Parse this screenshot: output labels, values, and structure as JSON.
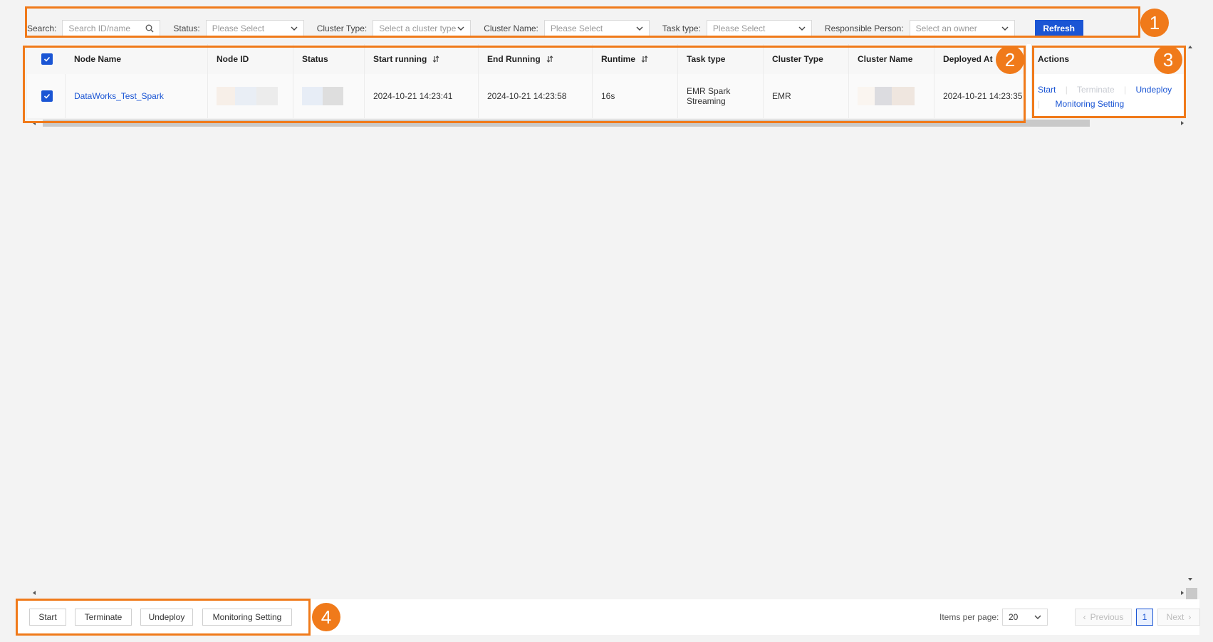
{
  "filters": {
    "search_label": "Search:",
    "search_placeholder": "Search ID/name",
    "status_label": "Status:",
    "status_value": "Please Select",
    "cluster_type_label": "Cluster Type:",
    "cluster_type_value": "Select a cluster type",
    "cluster_name_label": "Cluster Name:",
    "cluster_name_value": "Please Select",
    "task_type_label": "Task type:",
    "task_type_value": "Please Select",
    "responsible_label": "Responsible Person:",
    "responsible_value": "Select an owner",
    "refresh_label": "Refresh"
  },
  "table": {
    "headers": {
      "node_name": "Node Name",
      "node_id": "Node ID",
      "status": "Status",
      "start_running": "Start running",
      "end_running": "End Running",
      "runtime": "Runtime",
      "task_type": "Task type",
      "cluster_type": "Cluster Type",
      "cluster_name": "Cluster Name",
      "deployed_at": "Deployed At",
      "actions": "Actions"
    },
    "row": {
      "node_name": "DataWorks_Test_Spark",
      "start_running": "2024-10-21 14:23:41",
      "end_running": "2024-10-21 14:23:58",
      "runtime": "16s",
      "task_type_line1": "EMR Spark",
      "task_type_line2": "Streaming",
      "cluster_type": "EMR",
      "deployed_at": "2024-10-21 14:23:35",
      "actions": {
        "start": "Start",
        "terminate": "Terminate",
        "undeploy": "Undeploy",
        "monitoring": "Monitoring Setting"
      }
    }
  },
  "footer": {
    "start": "Start",
    "terminate": "Terminate",
    "undeploy": "Undeploy",
    "monitoring": "Monitoring Setting",
    "items_per_page_label": "Items per page:",
    "items_per_page_value": "20",
    "previous": "Previous",
    "current_page": "1",
    "next": "Next"
  },
  "callouts": [
    "1",
    "2",
    "3",
    "4"
  ],
  "colors": {
    "accent": "#1a55d4",
    "highlight": "#f07a1a"
  }
}
